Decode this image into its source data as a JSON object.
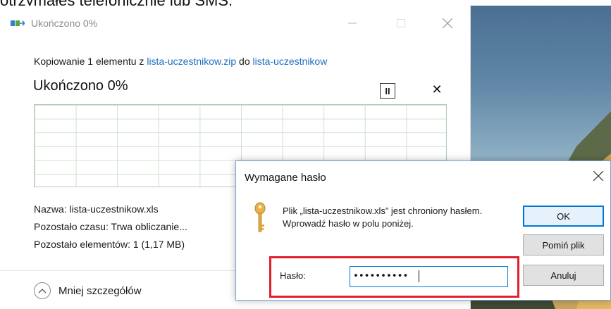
{
  "page_caption": "otrzymałeś telefonicznie lub SMS.",
  "copy_window": {
    "title": "Ukończono 0%",
    "copy_line": {
      "prefix": "Kopiowanie 1 elementu z ",
      "source": "lista-uczestnikow.zip",
      "middle": " do ",
      "destination": "lista-uczestnikow"
    },
    "progress_heading": "Ukończono 0%",
    "progress_value": 0,
    "pause_label": "II",
    "cancel_label": "✕",
    "details": {
      "name": "Nazwa: lista-uczestnikow.xls",
      "time_remaining": "Pozostało czasu: Trwa obliczanie...",
      "items_remaining": "Pozostało elementów: 1 (1,17 MB)"
    },
    "less_details_label": "Mniej szczegółów"
  },
  "password_dialog": {
    "title": "Wymagane hasło",
    "message": "Plik „lista-uczestnikow.xls” jest chroniony hasłem. Wprowadź hasło w polu poniżej.",
    "password_label": "Hasło:",
    "password_value": "••••••••••",
    "buttons": {
      "ok": "OK",
      "skip": "Pomiń plik",
      "cancel": "Anuluj"
    }
  },
  "icons": {
    "app": "copy-files-icon",
    "key": "key-icon",
    "chevron": "chevron-up-icon"
  },
  "colors": {
    "link": "#1b6fbf",
    "highlight_frame": "#e0202c",
    "focus": "#0078d7"
  }
}
